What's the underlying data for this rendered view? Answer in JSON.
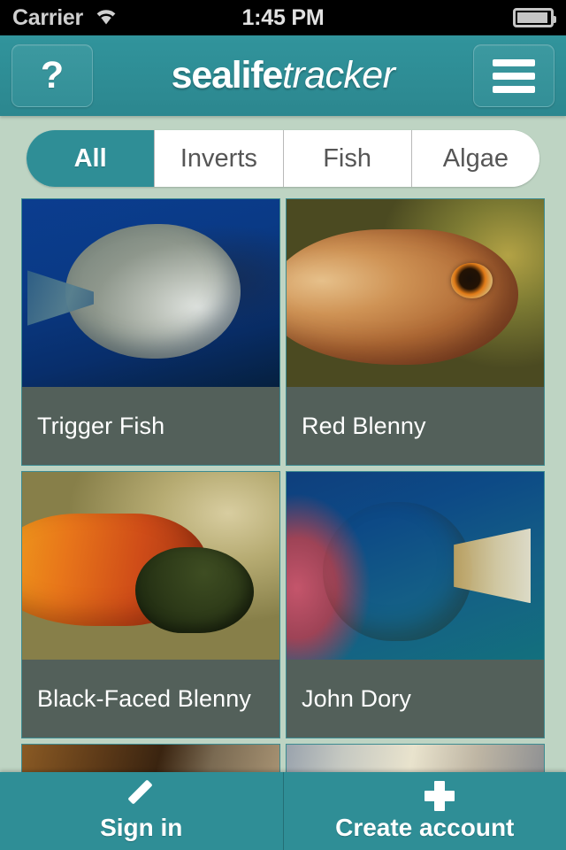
{
  "status_bar": {
    "carrier": "Carrier",
    "wifi_icon": "wifi-icon",
    "time": "1:45 PM",
    "battery_icon": "battery-icon"
  },
  "header": {
    "help_label": "?",
    "help_icon": "question-mark-icon",
    "brand_bold": "sealife",
    "brand_italic": "tracker",
    "menu_icon": "hamburger-menu-icon",
    "background_color": "#2f8e96"
  },
  "filter": {
    "selected": "All",
    "segments": [
      {
        "label": "All",
        "selected": true
      },
      {
        "label": "Inverts",
        "selected": false
      },
      {
        "label": "Fish",
        "selected": false
      },
      {
        "label": "Algae",
        "selected": false
      }
    ]
  },
  "grid": {
    "items": [
      {
        "name": "Trigger Fish"
      },
      {
        "name": "Red Blenny"
      },
      {
        "name": "Black-Faced Blenny"
      },
      {
        "name": "John Dory"
      }
    ]
  },
  "bottom_bar": {
    "sign_in": {
      "label": "Sign in",
      "icon": "compose-icon"
    },
    "create_account": {
      "label": "Create account",
      "icon": "plus-icon"
    },
    "background_color": "#2f8e96"
  },
  "theme": {
    "teal": "#2f8e96",
    "page_background": "#bed4c3",
    "card_label_background": "#53605a",
    "card_border": "#3d8b91"
  }
}
